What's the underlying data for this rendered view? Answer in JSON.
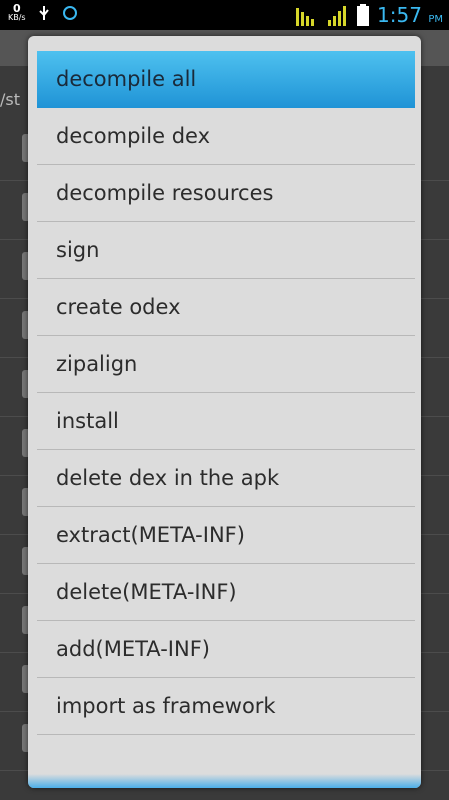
{
  "status_bar": {
    "speed_value": "0",
    "speed_unit": "KB/s",
    "time": "1:57",
    "ampm": "PM",
    "icons": [
      "usb-icon",
      "sync-icon",
      "signal-bars-icon",
      "cell-signal-icon",
      "battery-icon"
    ]
  },
  "background": {
    "path": "/st"
  },
  "menu": {
    "items": [
      {
        "label": "decompile all"
      },
      {
        "label": "decompile dex"
      },
      {
        "label": "decompile resources"
      },
      {
        "label": "sign"
      },
      {
        "label": "create odex"
      },
      {
        "label": "zipalign"
      },
      {
        "label": "install"
      },
      {
        "label": "delete dex in the apk"
      },
      {
        "label": "extract(META-INF)"
      },
      {
        "label": "delete(META-INF)"
      },
      {
        "label": "add(META-INF)"
      },
      {
        "label": "import as framework"
      }
    ]
  },
  "colors": {
    "selected": "#2fa6e3",
    "dialog_bg": "#dcdcdc",
    "clock": "#3ab8f0"
  }
}
